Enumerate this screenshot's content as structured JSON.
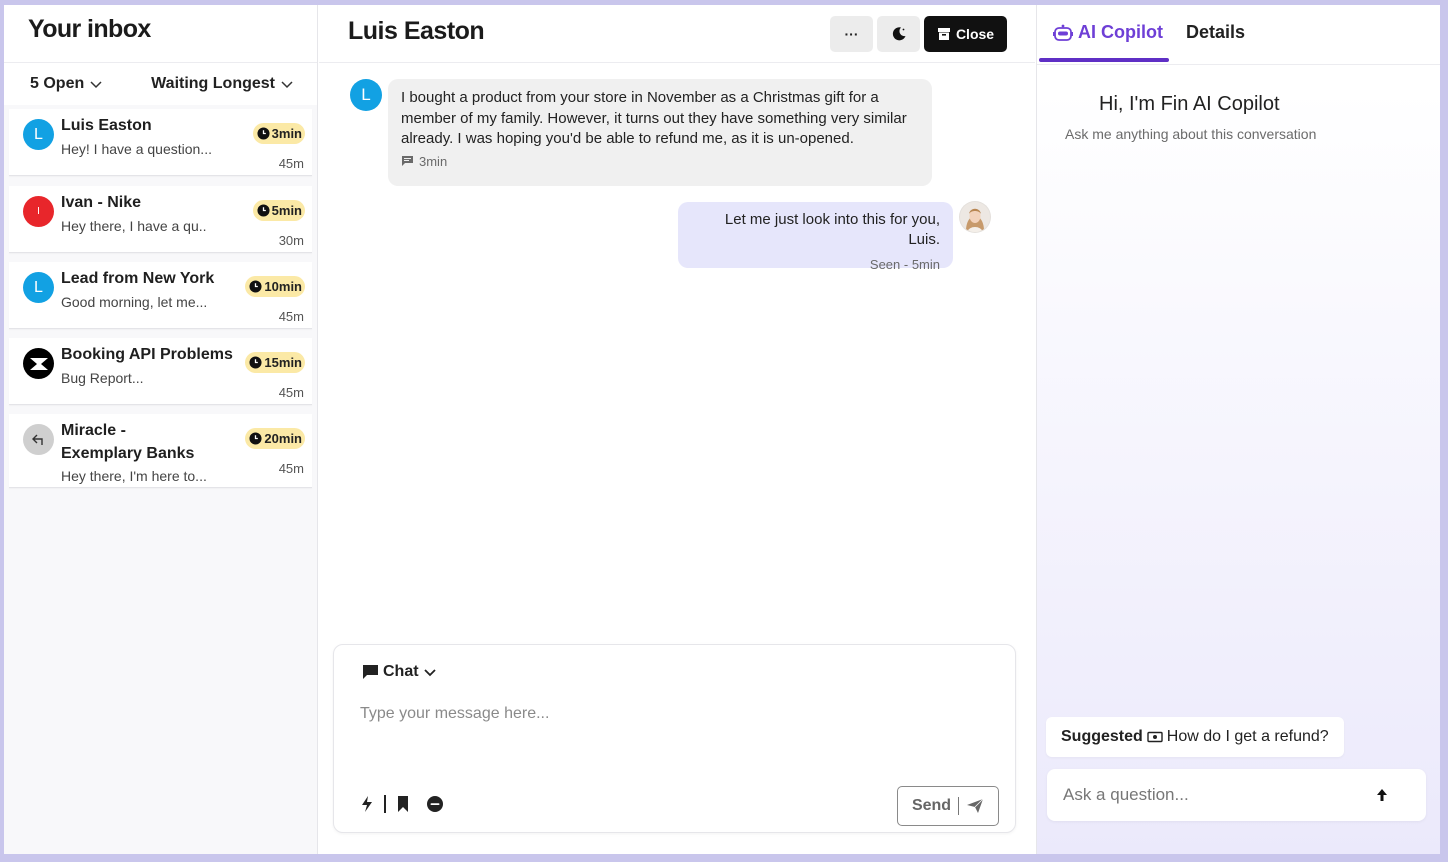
{
  "inbox": {
    "title": "Your inbox",
    "filter_status": "5 Open",
    "filter_sort": "Waiting Longest",
    "conversations": [
      {
        "name": "Luis Easton",
        "preview": "Hey! I have a question...",
        "wait": "3min",
        "time": "45m",
        "avatar_letter": "L",
        "avatar_color": "#12a1e3"
      },
      {
        "name": "Ivan - Nike",
        "preview": "Hey there, I have a qu..",
        "wait": "5min",
        "time": "30m",
        "avatar_letter": "I",
        "avatar_color": "#e8262b"
      },
      {
        "name": "Lead from New York",
        "preview": "Good morning, let me...",
        "wait": "10min",
        "time": "45m",
        "avatar_letter": "L",
        "avatar_color": "#12a1e3"
      },
      {
        "name": "Booking API Problems",
        "preview": "Bug Report...",
        "wait": "15min",
        "time": "45m",
        "avatar_letter": "",
        "avatar_color": "#000000"
      },
      {
        "name": "Miracle - Exemplary Banks",
        "preview": "Hey there, I'm here to...",
        "wait": "20min",
        "time": "45m",
        "avatar_letter": "",
        "avatar_color": "#cfcfcf"
      }
    ]
  },
  "conversation": {
    "title": "Luis Easton",
    "more_label": "···",
    "close_label": "Close",
    "customer_avatar_letter": "L",
    "messages": [
      {
        "from": "customer",
        "text": "I bought a product from your store in November as a Christmas gift for a member of my family. However, it turns out they have something very similar already. I was hoping you'd be able to refund me, as it is un-opened.",
        "meta": "3min"
      },
      {
        "from": "agent",
        "text": "Let me just look into this for you, Luis.",
        "meta": "Seen - 5min"
      }
    ]
  },
  "composer": {
    "mode_label": "Chat",
    "placeholder": "Type your message here...",
    "send_label": "Send"
  },
  "copilot": {
    "tab_active": "AI Copilot",
    "tab_details": "Details",
    "greeting": "Hi, I'm Fin AI Copilot",
    "subtitle": "Ask me anything about this conversation",
    "suggested_label": "Suggested",
    "suggested_question": "How do I get a refund?",
    "ask_placeholder": "Ask a question..."
  },
  "colors": {
    "accent": "#6e3fd6",
    "wait_badge": "#fbe9a6",
    "agent_bubble": "#e6e6fb",
    "customer_bubble": "#f0f0f0"
  }
}
